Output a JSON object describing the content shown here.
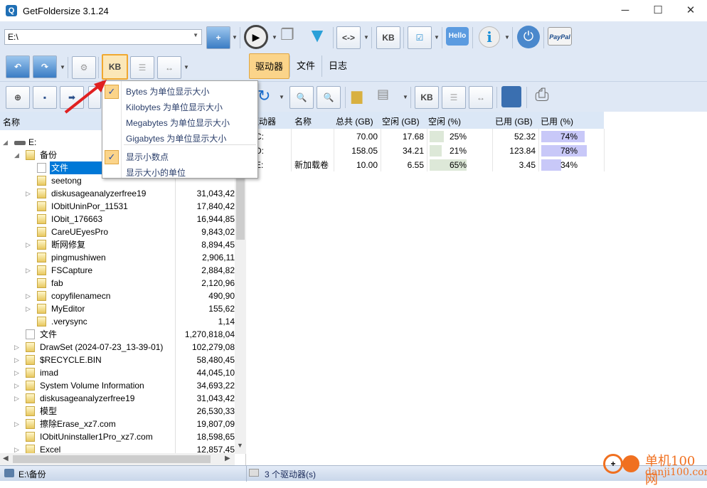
{
  "window": {
    "title": "GetFoldersize 3.1.24",
    "minimize": "─",
    "maximize": "☐",
    "close": "✕"
  },
  "toolbar": {
    "path_value": "E:\\",
    "hello_label": "Hello",
    "paypal_label": "PayPal",
    "kb_label": "KB",
    "tabs": [
      {
        "label": "驱动器",
        "active": true
      },
      {
        "label": "文件",
        "active": false
      },
      {
        "label": "日志",
        "active": false
      }
    ]
  },
  "menu": {
    "items": [
      {
        "label": "Bytes 为单位显示大小",
        "checked": true
      },
      {
        "label": "Kilobytes 为单位显示大小",
        "checked": false
      },
      {
        "label": "Megabytes 为单位显示大小",
        "checked": false
      },
      {
        "label": "Gigabytes 为单位显示大小",
        "checked": false
      },
      {
        "label": "显示小数点",
        "checked": true
      },
      {
        "label": "显示大小的单位",
        "checked": false
      }
    ],
    "check": "✓"
  },
  "tree": {
    "header": "名称",
    "rows": [
      {
        "name": "E:",
        "size": "",
        "level": 0,
        "type": "drive",
        "exp": "◢"
      },
      {
        "name": "备份",
        "size": "",
        "level": 1,
        "type": "folder",
        "exp": "◢"
      },
      {
        "name": "文件",
        "size": "",
        "level": 2,
        "type": "file",
        "exp": "",
        "selected": true
      },
      {
        "name": "seetong",
        "size": "",
        "level": 2,
        "type": "folder",
        "exp": ""
      },
      {
        "name": "diskusageanalyzerfree19",
        "size": "31,043,42",
        "level": 2,
        "type": "folder",
        "exp": "▷"
      },
      {
        "name": "IObitUninPor_11531",
        "size": "17,840,42",
        "level": 2,
        "type": "folder",
        "exp": ""
      },
      {
        "name": "IObit_176663",
        "size": "16,944,85",
        "level": 2,
        "type": "folder",
        "exp": ""
      },
      {
        "name": "CareUEyesPro",
        "size": "9,843,02",
        "level": 2,
        "type": "folder",
        "exp": ""
      },
      {
        "name": "断网修复",
        "size": "8,894,45",
        "level": 2,
        "type": "folder",
        "exp": "▷"
      },
      {
        "name": "pingmushiwen",
        "size": "2,906,11",
        "level": 2,
        "type": "folder",
        "exp": ""
      },
      {
        "name": "FSCapture",
        "size": "2,884,82",
        "level": 2,
        "type": "folder",
        "exp": "▷"
      },
      {
        "name": "fab",
        "size": "2,120,96",
        "level": 2,
        "type": "folder",
        "exp": ""
      },
      {
        "name": "copyfilenamecn",
        "size": "490,90",
        "level": 2,
        "type": "folder",
        "exp": "▷"
      },
      {
        "name": "MyEditor",
        "size": "155,62",
        "level": 2,
        "type": "folder",
        "exp": "▷"
      },
      {
        "name": ".verysync",
        "size": "1,14",
        "level": 2,
        "type": "folder",
        "exp": ""
      },
      {
        "name": "文件",
        "size": "1,270,818,04",
        "level": 1,
        "type": "file",
        "exp": ""
      },
      {
        "name": "DrawSet (2024-07-23_13-39-01)",
        "size": "102,279,08",
        "level": 1,
        "type": "folder",
        "exp": "▷"
      },
      {
        "name": "$RECYCLE.BIN",
        "size": "58,480,45",
        "level": 1,
        "type": "folder",
        "exp": "▷"
      },
      {
        "name": "imad",
        "size": "44,045,10",
        "level": 1,
        "type": "folder",
        "exp": "▷"
      },
      {
        "name": "System Volume Information",
        "size": "34,693,22",
        "level": 1,
        "type": "folder",
        "exp": "▷"
      },
      {
        "name": "diskusageanalyzerfree19",
        "size": "31,043,42",
        "level": 1,
        "type": "folder",
        "exp": "▷"
      },
      {
        "name": "模型",
        "size": "26,530,33",
        "level": 1,
        "type": "folder",
        "exp": ""
      },
      {
        "name": "擦除Erase_xz7.com",
        "size": "19,807,09",
        "level": 1,
        "type": "folder",
        "exp": "▷"
      },
      {
        "name": "IObitUninstaller1Pro_xz7.com",
        "size": "18,598,65",
        "level": 1,
        "type": "folder",
        "exp": ""
      },
      {
        "name": "Excel",
        "size": "12,857,45",
        "level": 1,
        "type": "folder",
        "exp": "▷"
      }
    ]
  },
  "drives": {
    "headers": [
      "驱动器",
      "名称",
      "总共 (GB)",
      "空闲 (GB)",
      "空闲 (%)",
      "已用 (GB)",
      "已用 (%)"
    ],
    "rows": [
      {
        "drive": "C:",
        "name": "",
        "total": "70.00",
        "free": "17.68",
        "free_pct": 25,
        "free_pct_label": "25%",
        "used": "52.32",
        "used_pct": 74,
        "used_pct_label": "74%"
      },
      {
        "drive": "D:",
        "name": "",
        "total": "158.05",
        "free": "34.21",
        "free_pct": 21,
        "free_pct_label": "21%",
        "used": "123.84",
        "used_pct": 78,
        "used_pct_label": "78%"
      },
      {
        "drive": "E:",
        "name": "新加载卷",
        "total": "10.00",
        "free": "6.55",
        "free_pct": 65,
        "free_pct_label": "65%",
        "used": "3.45",
        "used_pct": 34,
        "used_pct_label": "34%"
      }
    ]
  },
  "status": {
    "left": "E:\\备份",
    "right": "3 个驱动器(s)"
  },
  "watermark": {
    "brand": "单机100网",
    "url": "danji100.com"
  },
  "colors": {
    "accent": "#fbd48a",
    "selection": "#0078d7",
    "free_bar": "#dde8d8",
    "used_bar": "#c8c8f8"
  }
}
